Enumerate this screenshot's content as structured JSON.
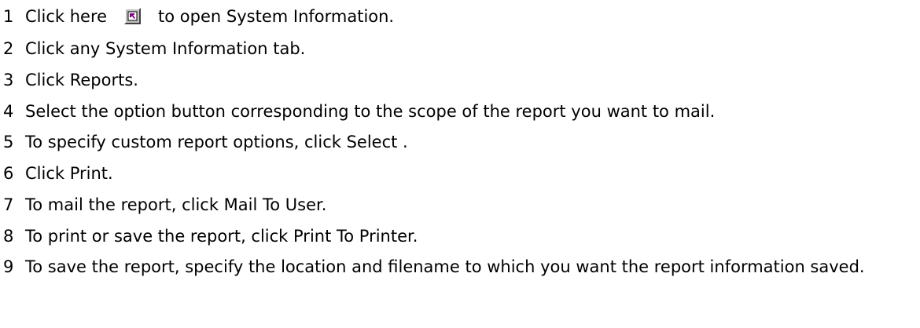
{
  "steps": [
    {
      "num": "1",
      "before": "Click here",
      "icon": "shortcut-arrow-icon",
      "after": "to open System Information."
    },
    {
      "num": "2",
      "text": "Click any System Information tab."
    },
    {
      "num": "3",
      "text": "Click Reports."
    },
    {
      "num": "4",
      "text": "Select the option button corresponding to the scope of the report you want to mail."
    },
    {
      "num": "5",
      "text": "To specify custom report options, click Select ."
    },
    {
      "num": "6",
      "text": "Click Print."
    },
    {
      "num": "7",
      "text": "To mail the report, click Mail To User."
    },
    {
      "num": "8",
      "text": "To print or save the report, click Print To Printer."
    },
    {
      "num": "9",
      "text": "To save the report, specify the location and filename to which you want the report information saved."
    }
  ],
  "colors": {
    "text": "#000000",
    "background": "#ffffff",
    "icon_face": "#c0c0c0",
    "icon_arrow": "#800080"
  }
}
